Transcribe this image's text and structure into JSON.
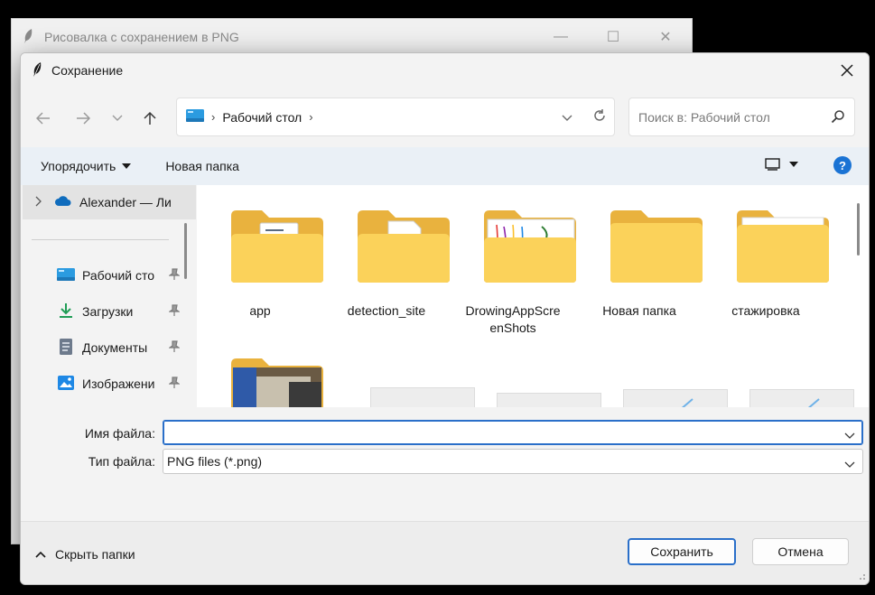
{
  "parent_window": {
    "title": "Рисовалка с сохранением в PNG",
    "minimize": "—",
    "maximize": "☐",
    "close": "✕"
  },
  "dialog": {
    "title": "Сохранение",
    "close": "✕"
  },
  "address_bar": {
    "path": "Рабочий стол",
    "separator": "›"
  },
  "search": {
    "placeholder": "Поиск в: Рабочий стол"
  },
  "toolbar": {
    "organize_label": "Упорядочить",
    "new_folder_label": "Новая папка",
    "help_label": "?"
  },
  "nav_pane": {
    "cloud_item": "Alexander — Ли",
    "items": [
      {
        "label": "Рабочий сто",
        "icon": "desktop-icon"
      },
      {
        "label": "Загрузки",
        "icon": "download-icon"
      },
      {
        "label": "Документы",
        "icon": "document-icon"
      },
      {
        "label": "Изображени",
        "icon": "pictures-icon"
      }
    ]
  },
  "files": [
    {
      "name": "app",
      "icon": "folder-with-document"
    },
    {
      "name": "detection_site",
      "icon": "folder-with-page"
    },
    {
      "name": "DrowingAppScre",
      "name2": "enShots",
      "icon": "folder-with-drawing"
    },
    {
      "name": "Новая папка",
      "icon": "empty-folder"
    },
    {
      "name": "стажировка",
      "icon": "folder-with-sheet"
    }
  ],
  "fields": {
    "filename_label": "Имя файла:",
    "filename_value": "",
    "filetype_label": "Тип файла:",
    "filetype_value": "PNG files (*.png)"
  },
  "footer": {
    "hide_folders_label": "Скрыть папки",
    "save_label": "Сохранить",
    "cancel_label": "Отмена"
  },
  "colors": {
    "accent": "#2a6fc9",
    "folder_yellow": "#f9c84a",
    "help_blue": "#1a73d4"
  }
}
